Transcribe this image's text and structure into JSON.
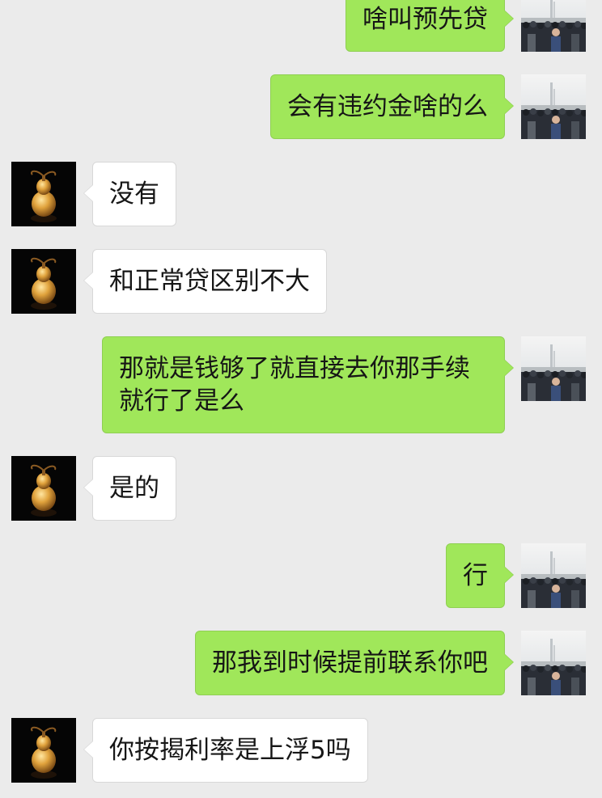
{
  "messages": [
    {
      "side": "me",
      "text": "啥叫预先贷"
    },
    {
      "side": "me",
      "text": "会有违约金啥的么"
    },
    {
      "side": "them",
      "text": "没有"
    },
    {
      "side": "them",
      "text": "和正常贷区别不大"
    },
    {
      "side": "me",
      "text": "那就是钱够了就直接去你那手续就行了是么"
    },
    {
      "side": "them",
      "text": "是的"
    },
    {
      "side": "me",
      "text": "行"
    },
    {
      "side": "me",
      "text": "那我到时候提前联系你吧"
    },
    {
      "side": "them",
      "text": "你按揭利率是上浮5吗"
    }
  ],
  "colors": {
    "background": "#ebebeb",
    "my_bubble": "#a0e75a",
    "their_bubble": "#ffffff"
  },
  "icons": {
    "my_avatar": "crowd-photo-avatar",
    "their_avatar": "gourd-photo-avatar"
  }
}
